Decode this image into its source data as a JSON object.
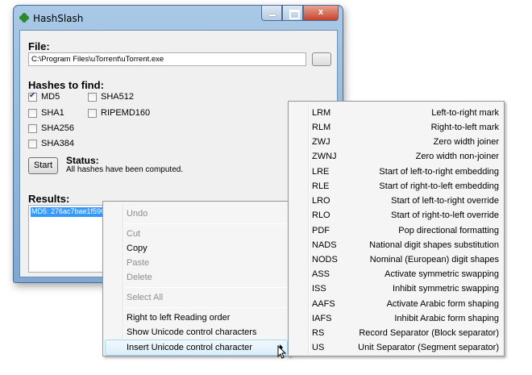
{
  "window": {
    "title": "HashSlash",
    "caption_close": "x"
  },
  "file": {
    "label": "File:",
    "path": "C:\\Program Files\\uTorrent\\uTorrent.exe"
  },
  "hashes": {
    "label": "Hashes to find:",
    "options": [
      {
        "name": "MD5",
        "checked": true
      },
      {
        "name": "SHA512",
        "checked": false
      },
      {
        "name": "SHA1",
        "checked": false
      },
      {
        "name": "RIPEMD160",
        "checked": false
      },
      {
        "name": "SHA256",
        "checked": false
      },
      {
        "name": "SHA384",
        "checked": false
      }
    ]
  },
  "actions": {
    "start_label": "Start"
  },
  "status": {
    "label": "Status:",
    "text": "All hashes have been computed."
  },
  "results": {
    "label": "Results:",
    "line": "MD5: 276ac7bae1f596"
  },
  "context_menu": {
    "items": [
      {
        "label": "Undo",
        "disabled": true
      },
      {
        "label": "Cut",
        "disabled": true
      },
      {
        "label": "Copy",
        "disabled": false
      },
      {
        "label": "Paste",
        "disabled": true
      },
      {
        "label": "Delete",
        "disabled": true
      },
      {
        "label": "Select All",
        "disabled": true
      },
      {
        "label": "Right to left Reading order",
        "disabled": false
      },
      {
        "label": "Show Unicode control characters",
        "disabled": false
      },
      {
        "label": "Insert Unicode control character",
        "disabled": false,
        "highlighted": true
      }
    ]
  },
  "submenu": {
    "items": [
      {
        "code": "LRM",
        "description": "Left-to-right mark"
      },
      {
        "code": "RLM",
        "description": "Right-to-left mark"
      },
      {
        "code": "ZWJ",
        "description": "Zero width joiner"
      },
      {
        "code": "ZWNJ",
        "description": "Zero width non-joiner"
      },
      {
        "code": "LRE",
        "description": "Start of left-to-right embedding"
      },
      {
        "code": "RLE",
        "description": "Start of right-to-left embedding"
      },
      {
        "code": "LRO",
        "description": "Start of left-to-right override"
      },
      {
        "code": "RLO",
        "description": "Start of right-to-left override"
      },
      {
        "code": "PDF",
        "description": "Pop directional formatting"
      },
      {
        "code": "NADS",
        "description": "National digit shapes substitution"
      },
      {
        "code": "NODS",
        "description": "Nominal (European) digit shapes"
      },
      {
        "code": "ASS",
        "description": "Activate symmetric swapping"
      },
      {
        "code": "ISS",
        "description": "Inhibit symmetric swapping"
      },
      {
        "code": "AAFS",
        "description": "Activate Arabic form shaping"
      },
      {
        "code": "IAFS",
        "description": "Inhibit Arabic form shaping"
      },
      {
        "code": "RS",
        "description": "Record Separator (Block separator)"
      },
      {
        "code": "US",
        "description": "Unit Separator (Segment separator)"
      }
    ]
  },
  "colors": {
    "selection": "#3399ff",
    "close_button": "#c7412b",
    "title_bar": "#a9c9e6"
  },
  "icons": [
    "clover-icon",
    "minimize-icon",
    "maximize-icon",
    "close-icon",
    "checkmark-icon",
    "submenu-arrow-icon",
    "mouse-cursor-icon"
  ]
}
